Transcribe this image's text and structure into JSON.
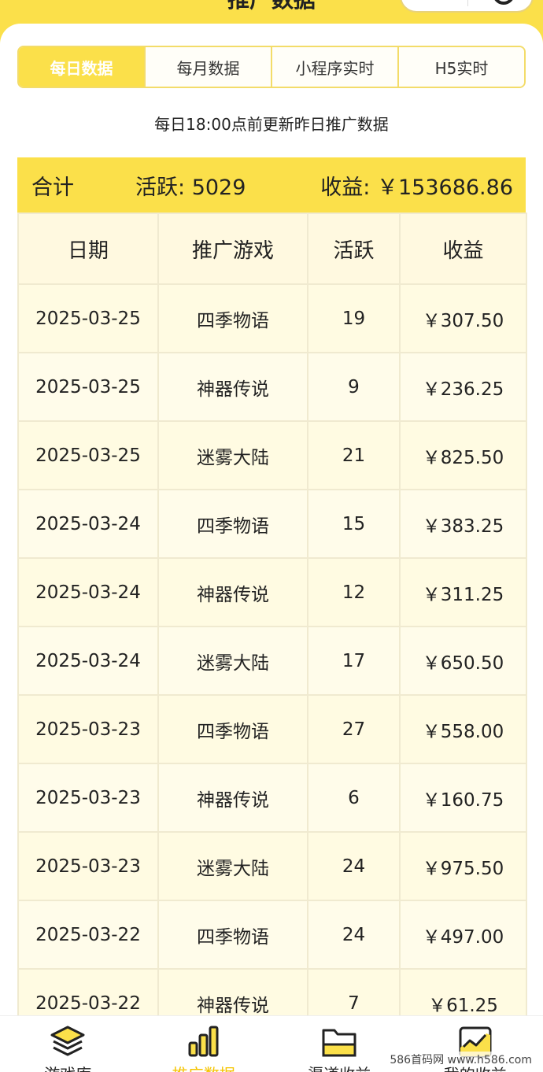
{
  "header": {
    "title": "推广数据"
  },
  "tabs": [
    {
      "label": "每日数据",
      "active": true
    },
    {
      "label": "每月数据",
      "active": false
    },
    {
      "label": "小程序实时",
      "active": false
    },
    {
      "label": "H5实时",
      "active": false
    }
  ],
  "notice": "每日18:00点前更新昨日推广数据",
  "summary": {
    "total_label": "合计",
    "active_label": "活跃:",
    "active_value": "5029",
    "income_label": "收益:",
    "income_value": "￥153686.86"
  },
  "table": {
    "headers": [
      "日期",
      "推广游戏",
      "活跃",
      "收益"
    ],
    "rows": [
      [
        "2025-03-25",
        "四季物语",
        "19",
        "￥307.50"
      ],
      [
        "2025-03-25",
        "神器传说",
        "9",
        "￥236.25"
      ],
      [
        "2025-03-25",
        "迷雾大陆",
        "21",
        "￥825.50"
      ],
      [
        "2025-03-24",
        "四季物语",
        "15",
        "￥383.25"
      ],
      [
        "2025-03-24",
        "神器传说",
        "12",
        "￥311.25"
      ],
      [
        "2025-03-24",
        "迷雾大陆",
        "17",
        "￥650.50"
      ],
      [
        "2025-03-23",
        "四季物语",
        "27",
        "￥558.00"
      ],
      [
        "2025-03-23",
        "神器传说",
        "6",
        "￥160.75"
      ],
      [
        "2025-03-23",
        "迷雾大陆",
        "24",
        "￥975.50"
      ],
      [
        "2025-03-22",
        "四季物语",
        "24",
        "￥497.00"
      ],
      [
        "2025-03-22",
        "神器传说",
        "7",
        "￥61.25"
      ]
    ]
  },
  "bottom_nav": [
    {
      "label": "游戏库",
      "icon": "layers-icon",
      "active": false
    },
    {
      "label": "推广数据",
      "icon": "bar-chart-icon",
      "active": true
    },
    {
      "label": "渠道收益",
      "icon": "folder-icon",
      "active": false
    },
    {
      "label": "我的收益",
      "icon": "trend-chart-icon",
      "active": false
    }
  ],
  "watermark": "586首码网 www.h586.com",
  "colors": {
    "accent": "#fbe04a",
    "active_nav": "#f5c400"
  }
}
